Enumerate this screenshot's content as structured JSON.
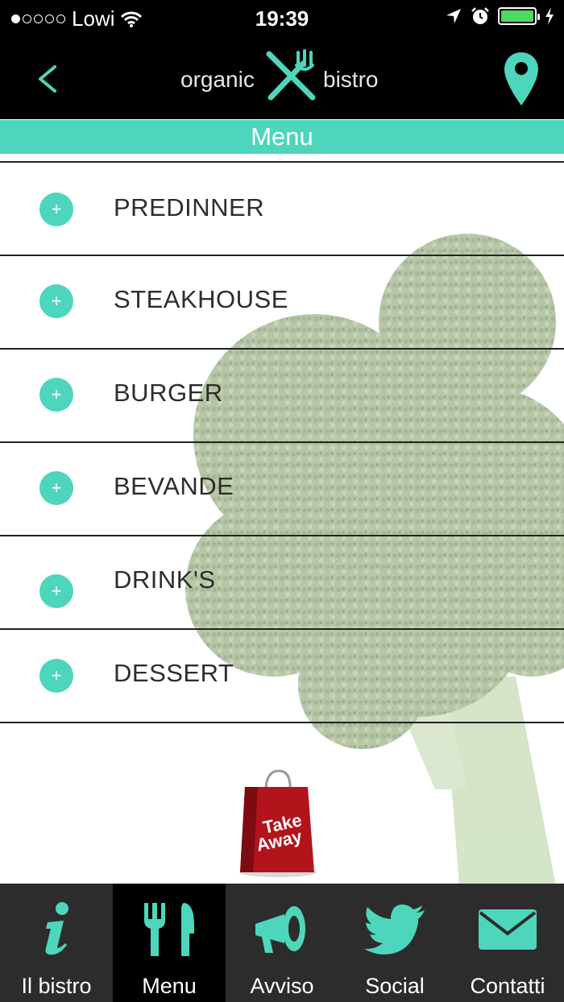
{
  "status_bar": {
    "carrier": "Lowi",
    "time": "19:39"
  },
  "nav": {
    "logo_left": "organic",
    "logo_right": "bistro"
  },
  "header": {
    "title": "Menu"
  },
  "menu": {
    "plus": "+",
    "items": [
      {
        "label": "PREDINNER"
      },
      {
        "label": "STEAKHOUSE"
      },
      {
        "label": "BURGER"
      },
      {
        "label": "BEVANDE"
      },
      {
        "label": "DRINK'S"
      },
      {
        "label": "DESSERT"
      }
    ]
  },
  "takeaway": {
    "line1": "Take",
    "line2": "Away"
  },
  "tabs": [
    {
      "label": "Il bistro",
      "icon": "info-icon"
    },
    {
      "label": "Menu",
      "icon": "fork-knife-icon"
    },
    {
      "label": "Avviso",
      "icon": "megaphone-icon"
    },
    {
      "label": "Social",
      "icon": "twitter-icon"
    },
    {
      "label": "Contatti",
      "icon": "envelope-icon"
    }
  ],
  "colors": {
    "accent": "#4dd6bb",
    "nav_bg": "#000000",
    "tab_bg": "#2c2c2c",
    "active_tab_bg": "#000000",
    "battery": "#4cd964"
  }
}
